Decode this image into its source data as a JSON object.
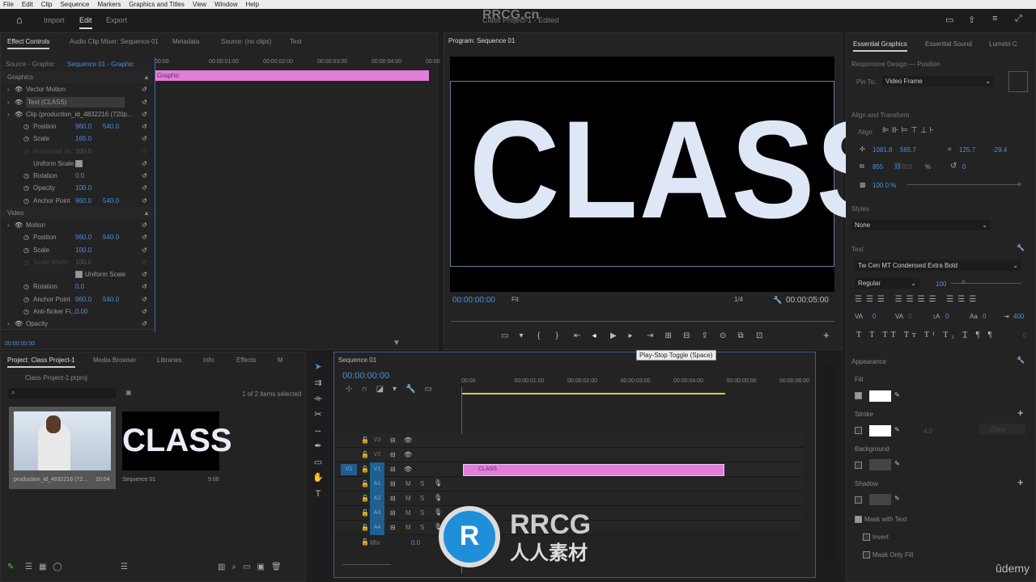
{
  "menu": [
    "File",
    "Edit",
    "Clip",
    "Sequence",
    "Markers",
    "Graphics and Titles",
    "View",
    "Window",
    "Help"
  ],
  "header": {
    "tabs": [
      "Import",
      "Edit",
      "Export"
    ],
    "active": "Edit",
    "title": "Class Project-1 - Edited"
  },
  "effect_controls": {
    "tabs": [
      "Effect Controls",
      "Audio Clip Mixer: Sequence 01",
      "Metadata",
      "Source: (no clips)",
      "Text"
    ],
    "source": "Source - Graphic",
    "sequence": "Sequence 01 - Graphic",
    "ruler": [
      "00:00",
      "00:00:01:00",
      "00:00:02:00",
      "00:00:03:00",
      "00:00:04:00",
      "00:00"
    ],
    "clip_label": "Graphic",
    "timecode": "00:00:00:00",
    "rows": [
      {
        "t": "section",
        "label": "Graphics"
      },
      {
        "t": "fx",
        "label": "Vector Motion"
      },
      {
        "t": "fx",
        "label": "Text (CLASS)",
        "sel": true
      },
      {
        "t": "fx",
        "label": "Clip (production_id_4832216 (720p..."
      },
      {
        "t": "prop",
        "label": "Position",
        "v1": "960.0",
        "v2": "540.0"
      },
      {
        "t": "prop",
        "label": "Scale",
        "v1": "165.0"
      },
      {
        "t": "prop",
        "label": "Horizontal Sc...",
        "v1": "100.0",
        "dis": true
      },
      {
        "t": "check",
        "label": "Uniform Scale"
      },
      {
        "t": "prop",
        "label": "Rotation",
        "v1": "0.0"
      },
      {
        "t": "prop",
        "label": "Opacity",
        "v1": "100.0"
      },
      {
        "t": "prop",
        "label": "Anchor Point",
        "v1": "960.0",
        "v2": "540.0"
      },
      {
        "t": "section",
        "label": "Video"
      },
      {
        "t": "fx",
        "label": "Motion"
      },
      {
        "t": "prop",
        "label": "Position",
        "v1": "960.0",
        "v2": "540.0"
      },
      {
        "t": "prop",
        "label": "Scale",
        "v1": "100.0"
      },
      {
        "t": "prop",
        "label": "Scale Width",
        "v1": "100.0",
        "dis": true
      },
      {
        "t": "check2",
        "label": "Uniform Scale"
      },
      {
        "t": "prop",
        "label": "Rotation",
        "v1": "0.0"
      },
      {
        "t": "prop",
        "label": "Anchor Point",
        "v1": "960.0",
        "v2": "540.0"
      },
      {
        "t": "prop",
        "label": "Anti-flicker Fi...",
        "v1": "0.00"
      },
      {
        "t": "fx",
        "label": "Opacity"
      }
    ]
  },
  "program": {
    "title": "Program: Sequence 01",
    "text": "CLASS",
    "timecode": "00:00:00:00",
    "fit": "Fit",
    "resolution": "1/4",
    "duration": "00:00:05:00",
    "tooltip": "Play-Stop Toggle (Space)"
  },
  "project": {
    "tabs": [
      "Project: Class Project-1",
      "Media Browser",
      "Libraries",
      "Info",
      "Effects",
      "M"
    ],
    "file": "Class Project-1.prproj",
    "selected": "1 of 2 items selected",
    "items": [
      {
        "name": "production_id_4832216 (72...",
        "dur": "10:04"
      },
      {
        "name": "Sequence 01",
        "dur": "5:00",
        "thumb": "CLASS"
      }
    ]
  },
  "timeline": {
    "tab": "Sequence 01",
    "timecode": "00:00:00:00",
    "ruler": [
      "00:00",
      "00:00:01:00",
      "00:00:02:00",
      "00:00:03:00",
      "00:00:04:00",
      "00:00:05:00",
      "00:00:06:00"
    ],
    "video_tracks": [
      "V3",
      "V2",
      "V1"
    ],
    "audio_tracks": [
      "A1",
      "A2",
      "A3",
      "A4"
    ],
    "source_patch": "V1",
    "mix_label": "Mix",
    "mix_value": "0.0",
    "clip": "CLASS",
    "clip_color": "#e07fd8"
  },
  "essential_graphics": {
    "tabs": [
      "Essential Graphics",
      "Essential Sound",
      "Lumetri C"
    ],
    "responsive": "Responsive Design — Position",
    "pin_to_label": "Pin To:",
    "pin_to": "Video Frame",
    "align_title": "Align and Transform",
    "align_label": "Align",
    "pos_x": "1081.8",
    "pos_y": "565.7",
    "anchor_x": "125.7",
    "anchor_y": "-29.4",
    "scale": "855",
    "scale2": "855",
    "pct": "%",
    "rotation": "0",
    "opacity": "100.0 %",
    "styles_title": "Styles",
    "style": "None",
    "text_title": "Text",
    "font": "Tw Cen MT Condensed Extra Bold",
    "font_style": "Regular",
    "font_size": "100",
    "tracking": [
      "0",
      "0",
      "0",
      "0",
      "400",
      "0"
    ],
    "appearance": "Appearance",
    "fill": "Fill",
    "stroke": "Stroke",
    "stroke_width": "4.0",
    "stroke_type": "Outer",
    "background": "Background",
    "shadow": "Shadow",
    "mask_text": "Mask with Text",
    "invert": "Invert",
    "mask_fill": "Mask Only Fill",
    "fill_color": "#ffffff"
  },
  "watermark": {
    "brand": "RRCG",
    "sub": "人人素材",
    "top": "RRCG.cn",
    "udemy": "ûdemy"
  }
}
